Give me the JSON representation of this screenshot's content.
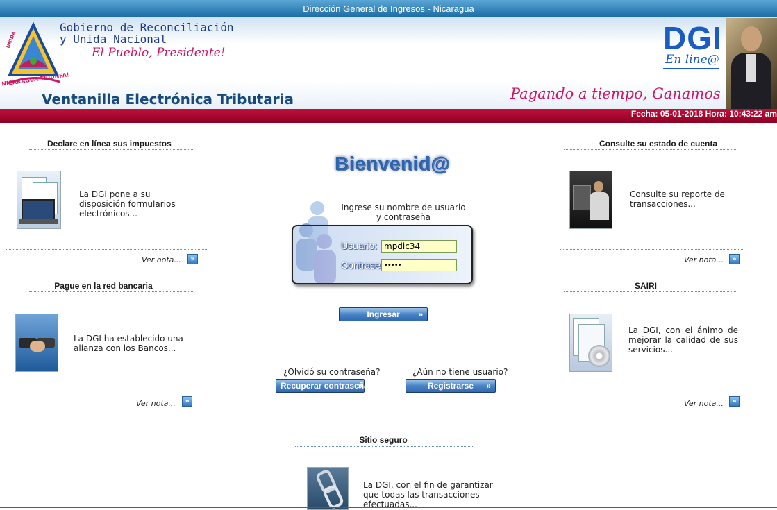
{
  "header": {
    "topbar_title": "Dirección General de Ingresos - Nicaragua",
    "gov_line1": "Gobierno de Reconciliación",
    "gov_line2": "y Unida Nacional",
    "gov_slogan": "El Pueblo, Presidente!",
    "logo_text_top": "UNIDA",
    "logo_text_bottom": "NICARAGUA TRIUNFA!",
    "app_title": "Ventanilla Electrónica Tributaria",
    "dgi_logo": "DGI",
    "dgi_online": "En line@",
    "slogan": "Pagando a tiempo, Ganamos todos!!",
    "datetime": "Fecha: 05-01-2018 Hora: 10:43:22 am"
  },
  "left": {
    "declare": {
      "title": "Declare en línea sus impuestos",
      "text": "La DGI pone a su disposición formularios electrónicos...",
      "link": "Ver nota..."
    },
    "pague": {
      "title": "Pague en la red bancaria",
      "text": "La DGI ha establecido una alianza con los Bancos...",
      "link": "Ver nota..."
    }
  },
  "right": {
    "consulte": {
      "title": "Consulte su estado de cuenta",
      "text": "Consulte su reporte de transacciones...",
      "link": "Ver nota..."
    },
    "sairi": {
      "title": "SAIRI",
      "text": "La DGI, con el ánimo de mejorar la calidad de sus servicios...",
      "link": "Ver nota..."
    }
  },
  "login": {
    "welcome": "Bienvenid@",
    "instruction": "Ingrese su nombre de usuario y contraseña",
    "user_label": "Usuario:",
    "user_value": "mpdic34",
    "pass_label": "Contraseña:",
    "pass_value": "•••••",
    "submit_label": "Ingresar",
    "forgot_prompt": "¿Olvidó su contraseña?",
    "forgot_button": "Recuperar contraseña",
    "register_prompt": "¿Aún no tiene usuario?",
    "register_button": "Registrarse",
    "chevron": "»"
  },
  "secure": {
    "title": "Sitio seguro",
    "text": "La DGI, con el fin de garantizar que todas las transacciones efectuadas..."
  },
  "arrow_glyph": "»"
}
